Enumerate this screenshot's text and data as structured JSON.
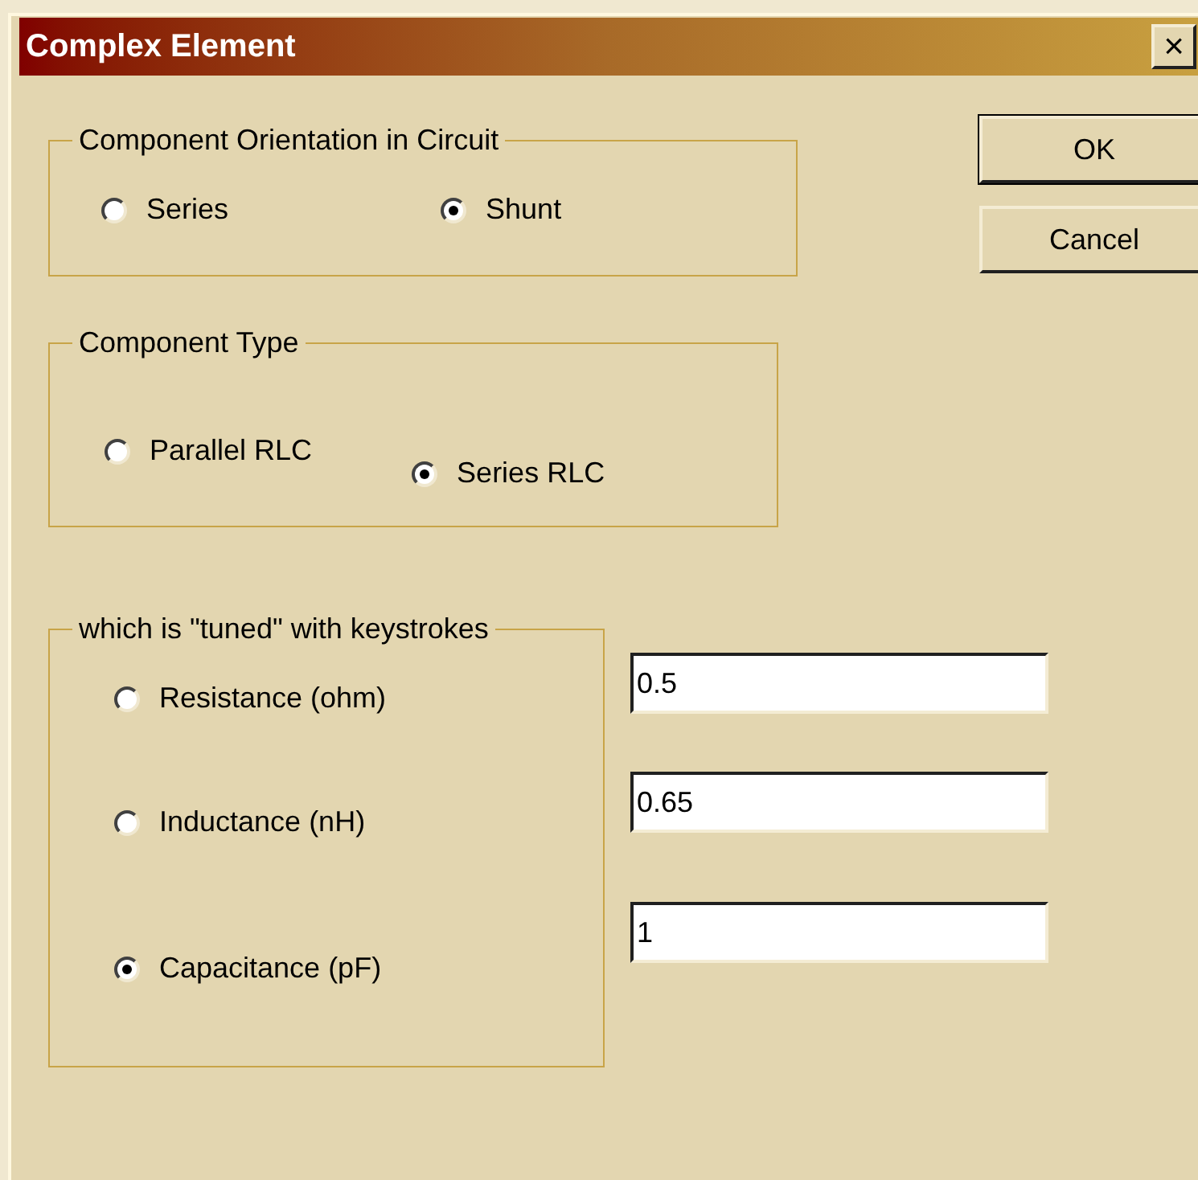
{
  "window": {
    "title": "Complex Element",
    "close": "×"
  },
  "orientation": {
    "legend": "Component Orientation in Circuit",
    "options": [
      {
        "label": "Series",
        "selected": false
      },
      {
        "label": "Shunt",
        "selected": true
      }
    ]
  },
  "component_type": {
    "legend": "Component Type",
    "options": [
      {
        "label": "Parallel RLC",
        "selected": false
      },
      {
        "label": "Series RLC",
        "selected": true
      }
    ]
  },
  "tuned": {
    "legend": "which is \"tuned\" with keystrokes",
    "options": [
      {
        "label": "Resistance (ohm)",
        "selected": false,
        "value": "0.5"
      },
      {
        "label": "Inductance (nH)",
        "selected": false,
        "value": "0.65"
      },
      {
        "label": "Capacitance (pF)",
        "selected": true,
        "value": "1"
      }
    ]
  },
  "buttons": [
    "OK",
    "Cancel"
  ]
}
